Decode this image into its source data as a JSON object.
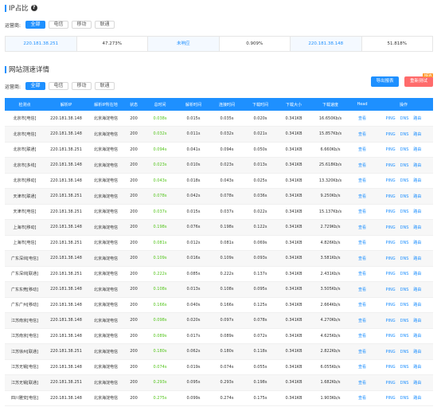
{
  "ip_section": {
    "title": "IP占比",
    "help": "?",
    "filter_label": "运营商:",
    "filters": [
      "全部",
      "电信",
      "移动",
      "联通"
    ],
    "active_filter": "全部",
    "cells": [
      "220.181.38.251",
      "47.273%",
      "未响应",
      "0.909%",
      "220.181.38.148",
      "51.818%"
    ]
  },
  "speed_section": {
    "title": "网站测速详情",
    "filter_label": "运营商:",
    "filters": [
      "全部",
      "电信",
      "移动",
      "联通"
    ],
    "active_filter": "全部",
    "export_button": "导出报表",
    "retest_button": "重新测试",
    "new_badge": "NEW"
  },
  "table": {
    "headers": [
      "检测点",
      "解析IP",
      "解析IP所在地",
      "状态",
      "总时间",
      "解析时间",
      "连接时间",
      "下载时间",
      "下载大小",
      "下载速度",
      "Head",
      "操作"
    ],
    "op_labels": [
      "PING",
      "DNS",
      "路由"
    ],
    "rows": [
      {
        "node": "北京市[电信]",
        "ip": "220.181.38.148",
        "loc": "北京海淀电信",
        "status": "200",
        "total": "0.038s",
        "dns": "0.015s",
        "conn": "0.035s",
        "dl": "0.020s",
        "size": "0.341KB",
        "speed": "16.650Kb/s",
        "head": "查看"
      },
      {
        "node": "北京市[电信]",
        "ip": "220.181.38.148",
        "loc": "北京海淀电信",
        "status": "200",
        "total": "0.032s",
        "dns": "0.011s",
        "conn": "0.032s",
        "dl": "0.021s",
        "size": "0.341KB",
        "speed": "15.857Kb/s",
        "head": "查看"
      },
      {
        "node": "北京市[联通]",
        "ip": "220.181.38.251",
        "loc": "北京海淀电信",
        "status": "200",
        "total": "0.094s",
        "dns": "0.041s",
        "conn": "0.094s",
        "dl": "0.050s",
        "size": "0.341KB",
        "speed": "6.660Kb/s",
        "head": "查看"
      },
      {
        "node": "北京市[多线]",
        "ip": "220.181.38.148",
        "loc": "北京海淀电信",
        "status": "200",
        "total": "0.023s",
        "dns": "0.010s",
        "conn": "0.023s",
        "dl": "0.013s",
        "size": "0.341KB",
        "speed": "25.618Kb/s",
        "head": "查看"
      },
      {
        "node": "北京市[移动]",
        "ip": "220.181.38.148",
        "loc": "北京海淀电信",
        "status": "200",
        "total": "0.043s",
        "dns": "0.018s",
        "conn": "0.043s",
        "dl": "0.025s",
        "size": "0.341KB",
        "speed": "13.320Kb/s",
        "head": "查看"
      },
      {
        "node": "天津市[联通]",
        "ip": "220.181.38.251",
        "loc": "北京海淀电信",
        "status": "200",
        "total": "0.078s",
        "dns": "0.042s",
        "conn": "0.078s",
        "dl": "0.036s",
        "size": "0.341KB",
        "speed": "9.250Kb/s",
        "head": "查看"
      },
      {
        "node": "天津市[电信]",
        "ip": "220.181.38.251",
        "loc": "北京海淀电信",
        "status": "200",
        "total": "0.037s",
        "dns": "0.015s",
        "conn": "0.037s",
        "dl": "0.022s",
        "size": "0.341KB",
        "speed": "15.137Kb/s",
        "head": "查看"
      },
      {
        "node": "上海市[移动]",
        "ip": "220.181.38.148",
        "loc": "北京海淀电信",
        "status": "200",
        "total": "0.198s",
        "dns": "0.076s",
        "conn": "0.198s",
        "dl": "0.122s",
        "size": "0.341KB",
        "speed": "2.729Kb/s",
        "head": "查看"
      },
      {
        "node": "上海市[电信]",
        "ip": "220.181.38.251",
        "loc": "北京海淀电信",
        "status": "200",
        "total": "0.081s",
        "dns": "0.012s",
        "conn": "0.081s",
        "dl": "0.069s",
        "size": "0.341KB",
        "speed": "4.826Kb/s",
        "head": "查看"
      },
      {
        "node": "广东深圳[电信]",
        "ip": "220.181.38.148",
        "loc": "北京海淀电信",
        "status": "200",
        "total": "0.109s",
        "dns": "0.016s",
        "conn": "0.109s",
        "dl": "0.093s",
        "size": "0.341KB",
        "speed": "3.581Kb/s",
        "head": "查看"
      },
      {
        "node": "广东深圳[联通]",
        "ip": "220.181.38.251",
        "loc": "北京海淀电信",
        "status": "200",
        "total": "0.222s",
        "dns": "0.085s",
        "conn": "0.222s",
        "dl": "0.137s",
        "size": "0.341KB",
        "speed": "2.431Kb/s",
        "head": "查看"
      },
      {
        "node": "广东东莞[移动]",
        "ip": "220.181.38.148",
        "loc": "北京海淀电信",
        "status": "200",
        "total": "0.108s",
        "dns": "0.013s",
        "conn": "0.108s",
        "dl": "0.095s",
        "size": "0.341KB",
        "speed": "3.505Kb/s",
        "head": "查看"
      },
      {
        "node": "广东广州[移动]",
        "ip": "220.181.38.148",
        "loc": "北京海淀电信",
        "status": "200",
        "total": "0.166s",
        "dns": "0.040s",
        "conn": "0.166s",
        "dl": "0.125s",
        "size": "0.341KB",
        "speed": "2.664Kb/s",
        "head": "查看"
      },
      {
        "node": "江苏南京[电信]",
        "ip": "220.181.38.148",
        "loc": "北京海淀电信",
        "status": "200",
        "total": "0.098s",
        "dns": "0.020s",
        "conn": "0.097s",
        "dl": "0.078s",
        "size": "0.341KB",
        "speed": "4.270Kb/s",
        "head": "查看"
      },
      {
        "node": "江苏南京[电信]",
        "ip": "220.181.38.148",
        "loc": "北京海淀电信",
        "status": "200",
        "total": "0.089s",
        "dns": "0.017s",
        "conn": "0.089s",
        "dl": "0.072s",
        "size": "0.341KB",
        "speed": "4.625Kb/s",
        "head": "查看"
      },
      {
        "node": "江苏徐州[联通]",
        "ip": "220.181.38.251",
        "loc": "北京海淀电信",
        "status": "200",
        "total": "0.180s",
        "dns": "0.062s",
        "conn": "0.180s",
        "dl": "0.118s",
        "size": "0.341KB",
        "speed": "2.822Kb/s",
        "head": "查看"
      },
      {
        "node": "江苏无锡[电信]",
        "ip": "220.181.38.148",
        "loc": "北京海淀电信",
        "status": "200",
        "total": "0.074s",
        "dns": "0.019s",
        "conn": "0.074s",
        "dl": "0.055s",
        "size": "0.341KB",
        "speed": "6.055Kb/s",
        "head": "查看"
      },
      {
        "node": "江苏无锡[联通]",
        "ip": "220.181.38.251",
        "loc": "北京海淀电信",
        "status": "200",
        "total": "0.293s",
        "dns": "0.095s",
        "conn": "0.293s",
        "dl": "0.198s",
        "size": "0.341KB",
        "speed": "1.682Kb/s",
        "head": "查看"
      },
      {
        "node": "四川雅安[电信]",
        "ip": "220.181.38.148",
        "loc": "北京海淀电信",
        "status": "200",
        "total": "0.275s",
        "dns": "0.099s",
        "conn": "0.274s",
        "dl": "0.175s",
        "size": "0.341KB",
        "speed": "1.903Kb/s",
        "head": "查看"
      }
    ]
  }
}
